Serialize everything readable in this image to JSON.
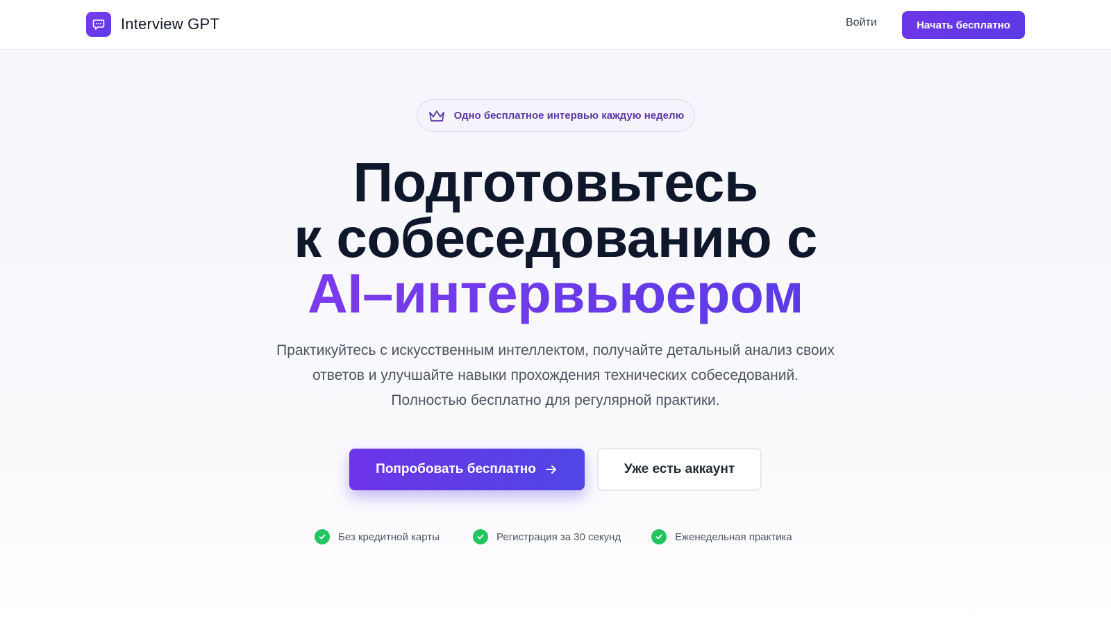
{
  "header": {
    "brand": "Interview GPT",
    "login_label": "Войти",
    "cta_label": "Начать бесплатно"
  },
  "hero": {
    "badge_text": "Одно бесплатное интервью каждую неделю",
    "headline_line1": "Подготовьтесь",
    "headline_line2": "к собеседованию с",
    "headline_accent": "AI–интервьюером",
    "subtitle_line1": "Практикуйтесь с искусственным интеллектом, получайте детальный анализ своих",
    "subtitle_line2": "ответов и улучшайте навыки прохождения технических собеседований.",
    "subtitle_line3": "Полностью бесплатно для регулярной практики.",
    "primary_button": "Попробовать бесплатно",
    "secondary_button": "Уже есть аккаунт",
    "features": [
      "Без кредитной карты",
      "Регистрация за 30 секунд",
      "Еженедельная практика"
    ]
  },
  "icons": {
    "logo": "chat-bubble-icon",
    "badge": "crown-icon",
    "primary_button": "arrow-right-icon",
    "feature": "check-circle-icon"
  },
  "colors": {
    "accent": "#6d35e8",
    "accent_end": "#4f46e5",
    "check": "#22c55e",
    "headline": "#0f172a"
  }
}
